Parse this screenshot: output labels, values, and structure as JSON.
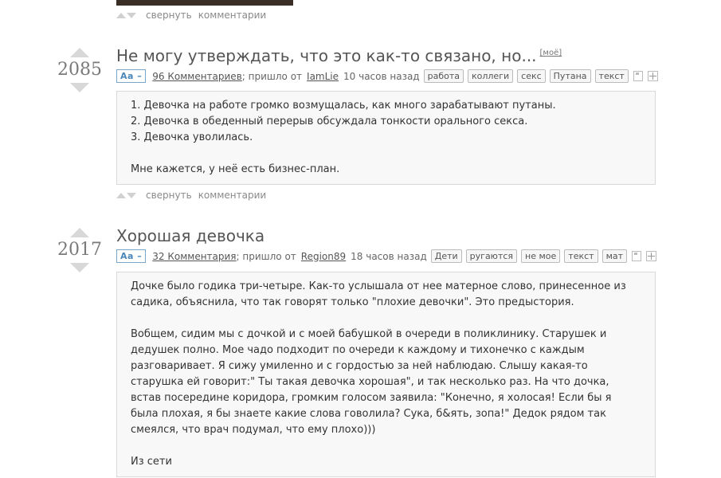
{
  "common": {
    "collapse": "свернуть",
    "comments": "комментарии"
  },
  "post1": {
    "score": "2085",
    "title": "Не могу утверждать, что это как-то связано, но...",
    "mine": "[моё]",
    "font_toggle": "Aa –",
    "comments_link": "96 Комментариев",
    "from_text": "; пришло от",
    "author": "IamLie",
    "time": "10 часов назад",
    "tags": [
      "работа",
      "коллеги",
      "секс",
      "Путана",
      "текст"
    ],
    "lines": [
      "1. Девочка на работе громко возмущалась, как много зарабатывают путаны.",
      "2. Девочка в обеденный перерыв обсуждала тонкости орального секса.",
      "3. Девочка уволилась."
    ],
    "ending": "Мне кажется, у неё есть бизнес-план."
  },
  "post2": {
    "score": "2017",
    "title": "Хорошая девочка",
    "font_toggle": "Aa –",
    "comments_link": "32 Комментария",
    "from_text": "; пришло от",
    "author": "Region89",
    "time": "18 часов назад",
    "tags": [
      "Дети",
      "ругаются",
      "не мое",
      "текст",
      "мат"
    ],
    "para1": "Дочке было годика три-четыре. Как-то услышала от нее матерное слово, принесенное из садика, объяснила, что так говорят только \"плохие девочки\". Это предыстория.",
    "para2": "Вобщем, сидим мы с дочкой и с моей бабушкой в очереди в поликлинику. Старушек и дедушек полно. Мое чадо подходит по очереди к каждому и тихонечко с каждым разговаривает. Я сижу умиленно и с гордостью за ней наблюдаю. Слышу какая-то старушка ей говорит:\" Ты такая девочка хорошая\", и так несколько раз. На что дочка, встав посередине коридора, громким голосом заявила: \"Конечно, я холосая! Если бы я была плохая, я бы знаете какие слова говолила? Сука, б&ять, зопа!\" Дедок рядом так смеялся, что врач подумал, что ему плохо)))",
    "source": "Из сети"
  }
}
